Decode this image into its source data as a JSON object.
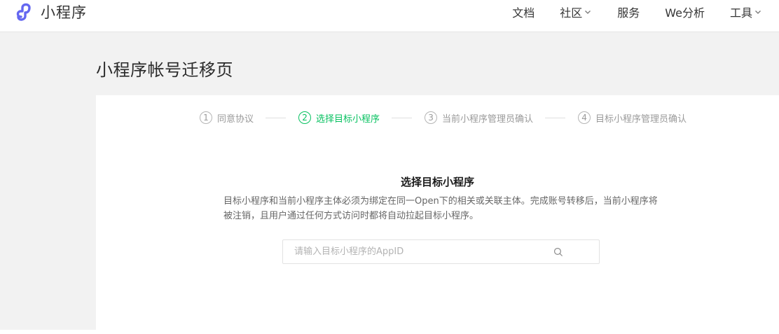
{
  "header": {
    "logo_text": "小程序",
    "nav": [
      {
        "label": "文档",
        "has_dropdown": false
      },
      {
        "label": "社区",
        "has_dropdown": true
      },
      {
        "label": "服务",
        "has_dropdown": false
      },
      {
        "label": "We分析",
        "has_dropdown": false
      },
      {
        "label": "工具",
        "has_dropdown": true
      }
    ]
  },
  "page": {
    "title": "小程序帐号迁移页"
  },
  "steps": [
    {
      "num": "1",
      "label": "同意协议",
      "active": false
    },
    {
      "num": "2",
      "label": "选择目标小程序",
      "active": true
    },
    {
      "num": "3",
      "label": "当前小程序管理员确认",
      "active": false
    },
    {
      "num": "4",
      "label": "目标小程序管理员确认",
      "active": false
    }
  ],
  "section": {
    "title": "选择目标小程序",
    "description": "目标小程序和当前小程序主体必须为绑定在同一Open下的相关或关联主体。完成账号转移后，当前小程序将被注销，且用户通过任何方式访问时都将自动拉起目标小程序。"
  },
  "search": {
    "placeholder": "请输入目标小程序的AppID",
    "value": ""
  },
  "colors": {
    "accent": "#07c160",
    "logo": "#6467f0",
    "background": "#f2f2f2"
  }
}
